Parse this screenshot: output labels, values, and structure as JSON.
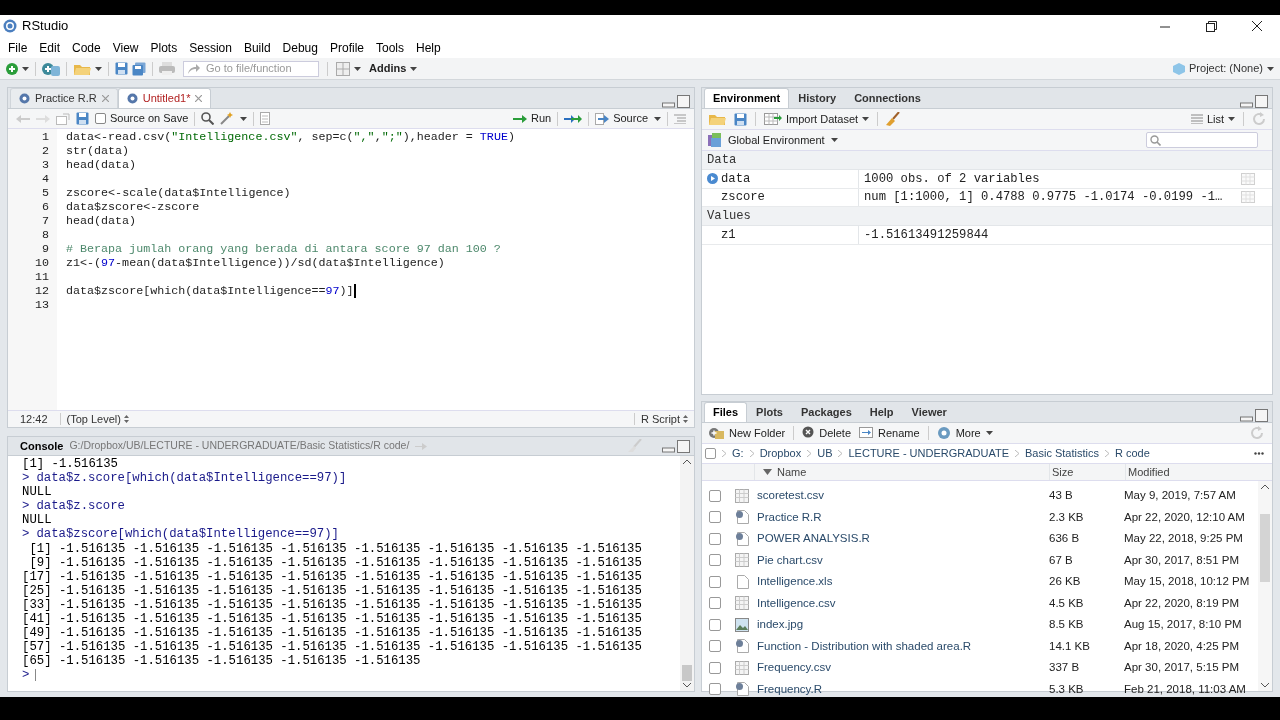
{
  "window": {
    "title": "RStudio"
  },
  "menu": [
    "File",
    "Edit",
    "Code",
    "View",
    "Plots",
    "Session",
    "Build",
    "Debug",
    "Profile",
    "Tools",
    "Help"
  ],
  "toolbar": {
    "goto_placeholder": "Go to file/function",
    "addins": "Addins",
    "project": "Project: (None)"
  },
  "editor": {
    "tabs": [
      {
        "label": "Practice R.R",
        "selected": false,
        "modified": false
      },
      {
        "label": "Untitled1*",
        "selected": true,
        "modified": true
      }
    ],
    "source_on_save": {
      "label": "Source on Save",
      "checked": false
    },
    "run": "Run",
    "source": "Source",
    "lines": [
      {
        "n": "1",
        "kind": "code",
        "text": "data<-read.csv(\"Intelligence.csv\", sep=c(\",\",\";\"),header = TRUE)"
      },
      {
        "n": "2",
        "kind": "code",
        "text": "str(data)"
      },
      {
        "n": "3",
        "kind": "code",
        "text": "head(data)"
      },
      {
        "n": "4"
      },
      {
        "n": "5",
        "kind": "code",
        "text": "zscore<-scale(data$Intelligence)"
      },
      {
        "n": "6",
        "kind": "code",
        "text": "data$zscore<-zscore"
      },
      {
        "n": "7",
        "kind": "code",
        "text": "head(data)"
      },
      {
        "n": "8"
      },
      {
        "n": "9",
        "kind": "comment",
        "text": "# Berapa jumlah orang yang berada di antara score 97 dan 100 ?"
      },
      {
        "n": "10",
        "kind": "code",
        "text": "z1<-(97-mean(data$Intelligence))/sd(data$Intelligence)"
      },
      {
        "n": "11"
      },
      {
        "n": "12",
        "kind": "code",
        "text": "data$zscore[which(data$Intelligence==97)]",
        "cursor": true
      },
      {
        "n": "13"
      }
    ],
    "status": {
      "position": "12:42",
      "scope": "(Top Level)",
      "type": "R Script"
    }
  },
  "console": {
    "title": "Console",
    "path": "G:/Dropbox/UB/LECTURE - UNDERGRADUATE/Basic Statistics/R code/",
    "lines": [
      {
        "kind": "output",
        "text": "[1] -1.516135"
      },
      {
        "kind": "input",
        "prompt": ">",
        "text": "data$z.score[which(data$Intelligence==97)]"
      },
      {
        "kind": "output",
        "text": "NULL"
      },
      {
        "kind": "input",
        "prompt": ">",
        "text": "data$z.score"
      },
      {
        "kind": "output",
        "text": "NULL"
      },
      {
        "kind": "input",
        "prompt": ">",
        "text": "data$zscore[which(data$Intelligence==97)]"
      },
      {
        "kind": "output",
        "text": " [1] -1.516135 -1.516135 -1.516135 -1.516135 -1.516135 -1.516135 -1.516135 -1.516135"
      },
      {
        "kind": "output",
        "text": " [9] -1.516135 -1.516135 -1.516135 -1.516135 -1.516135 -1.516135 -1.516135 -1.516135"
      },
      {
        "kind": "output",
        "text": "[17] -1.516135 -1.516135 -1.516135 -1.516135 -1.516135 -1.516135 -1.516135 -1.516135"
      },
      {
        "kind": "output",
        "text": "[25] -1.516135 -1.516135 -1.516135 -1.516135 -1.516135 -1.516135 -1.516135 -1.516135"
      },
      {
        "kind": "output",
        "text": "[33] -1.516135 -1.516135 -1.516135 -1.516135 -1.516135 -1.516135 -1.516135 -1.516135"
      },
      {
        "kind": "output",
        "text": "[41] -1.516135 -1.516135 -1.516135 -1.516135 -1.516135 -1.516135 -1.516135 -1.516135"
      },
      {
        "kind": "output",
        "text": "[49] -1.516135 -1.516135 -1.516135 -1.516135 -1.516135 -1.516135 -1.516135 -1.516135"
      },
      {
        "kind": "output",
        "text": "[57] -1.516135 -1.516135 -1.516135 -1.516135 -1.516135 -1.516135 -1.516135 -1.516135"
      },
      {
        "kind": "output",
        "text": "[65] -1.516135 -1.516135 -1.516135 -1.516135 -1.516135"
      },
      {
        "kind": "prompt",
        "prompt": ">"
      }
    ]
  },
  "environment": {
    "tabs": [
      {
        "label": "Environment",
        "selected": true
      },
      {
        "label": "History",
        "selected": false
      },
      {
        "label": "Connections",
        "selected": false
      }
    ],
    "import": "Import Dataset",
    "view": "List",
    "scope": "Global Environment",
    "sections": [
      {
        "title": "Data",
        "rows": [
          {
            "kind": "dataframe",
            "name": "data",
            "value": "1000 obs. of 2 variables"
          },
          {
            "kind": "column",
            "name": "zscore",
            "value": "num [1:1000, 1] 0.4788 0.9775 -1.0174 -0.0199 -1…"
          }
        ]
      },
      {
        "title": "Values",
        "rows": [
          {
            "kind": "value",
            "name": "z1",
            "value": "-1.51613491259844"
          }
        ]
      }
    ]
  },
  "files": {
    "tabs": [
      {
        "label": "Files",
        "selected": true
      },
      {
        "label": "Plots",
        "selected": false
      },
      {
        "label": "Packages",
        "selected": false
      },
      {
        "label": "Help",
        "selected": false
      },
      {
        "label": "Viewer",
        "selected": false
      }
    ],
    "actions": [
      "New Folder",
      "Delete",
      "Rename",
      "More"
    ],
    "select_all": {
      "checked": false
    },
    "path": [
      "G:",
      "Dropbox",
      "UB",
      "LECTURE - UNDERGRADUATE",
      "Basic Statistics",
      "R code"
    ],
    "columns": [
      "Name",
      "Size",
      "Modified"
    ],
    "rows": [
      {
        "kind": "csv",
        "name": "scoretest.csv",
        "size": "43 B",
        "modified": "May 9, 2019, 7:57 AM",
        "checked": false
      },
      {
        "kind": "r",
        "name": "Practice R.R",
        "size": "2.3 KB",
        "modified": "Apr 22, 2020, 12:10 AM",
        "checked": false
      },
      {
        "kind": "r",
        "name": "POWER ANALYSIS.R",
        "size": "636 B",
        "modified": "May 22, 2018, 9:25 PM",
        "checked": false
      },
      {
        "kind": "csv",
        "name": "Pie chart.csv",
        "size": "67 B",
        "modified": "Apr 30, 2017, 8:51 PM",
        "checked": false
      },
      {
        "kind": "file",
        "name": "Intelligence.xls",
        "size": "26 KB",
        "modified": "May 15, 2018, 10:12 PM",
        "checked": false
      },
      {
        "kind": "csv",
        "name": "Intelligence.csv",
        "size": "4.5 KB",
        "modified": "Apr 22, 2020, 8:19 PM",
        "checked": false
      },
      {
        "kind": "image",
        "name": "index.jpg",
        "size": "8.5 KB",
        "modified": "Aug 15, 2017, 8:10 PM",
        "checked": false
      },
      {
        "kind": "r",
        "name": "Function - Distribution with shaded area.R",
        "size": "14.1 KB",
        "modified": "Apr 18, 2020, 4:25 PM",
        "checked": false
      },
      {
        "kind": "csv",
        "name": "Frequency.csv",
        "size": "337 B",
        "modified": "Apr 30, 2017, 5:15 PM",
        "checked": false
      },
      {
        "kind": "r",
        "name": "Frequency.R",
        "size": "5.3 KB",
        "modified": "Feb 21, 2018, 11:03 AM",
        "checked": false
      }
    ]
  }
}
